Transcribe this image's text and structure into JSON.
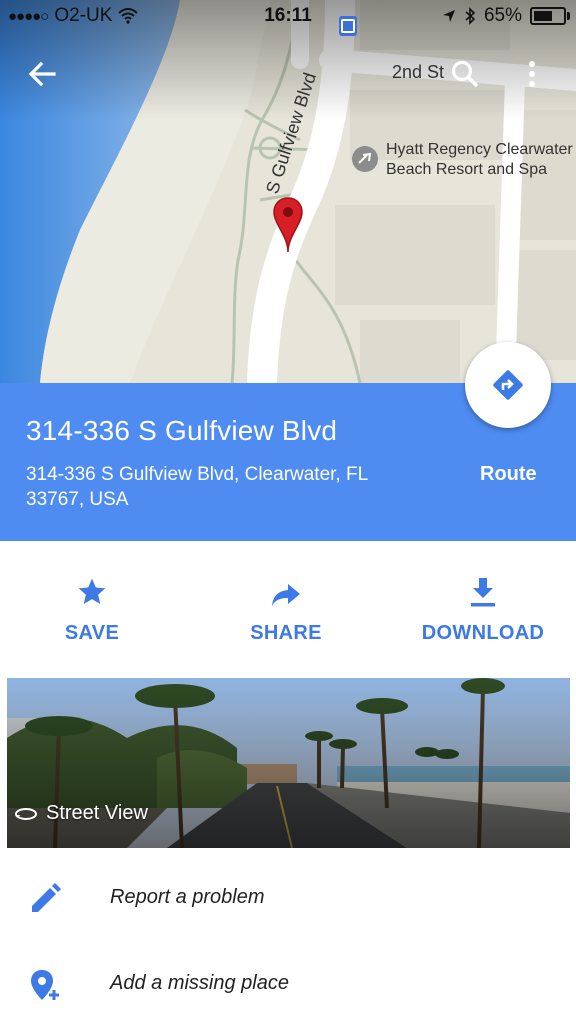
{
  "status_bar": {
    "signal_dots": "●●●●○",
    "carrier": "O2-UK",
    "time": "16:11",
    "battery": "65%"
  },
  "map": {
    "street_2nd": "2nd St",
    "street_gulfview": "S Gulfview Blvd",
    "poi_line1": "Hyatt Regency Clearwater",
    "poi_line2": "Beach Resort and Spa",
    "icons": [
      "back-arrow-icon",
      "search-icon",
      "more-vert-icon",
      "bus-stop-icon",
      "map-pin-icon",
      "poi-icon"
    ]
  },
  "place": {
    "title": "314-336 S Gulfview Blvd",
    "address_line1": "314-336 S Gulfview Blvd, Clearwater, FL",
    "address_line2": "33767, USA",
    "route_label": "Route",
    "accent": "#4e8cf2"
  },
  "actions": {
    "save": "SAVE",
    "share": "SHARE",
    "download": "DOWNLOAD",
    "color": "#3d7ae6"
  },
  "street_view": {
    "label": "Street View"
  },
  "list": {
    "report": "Report a problem",
    "add_place": "Add a missing place"
  }
}
